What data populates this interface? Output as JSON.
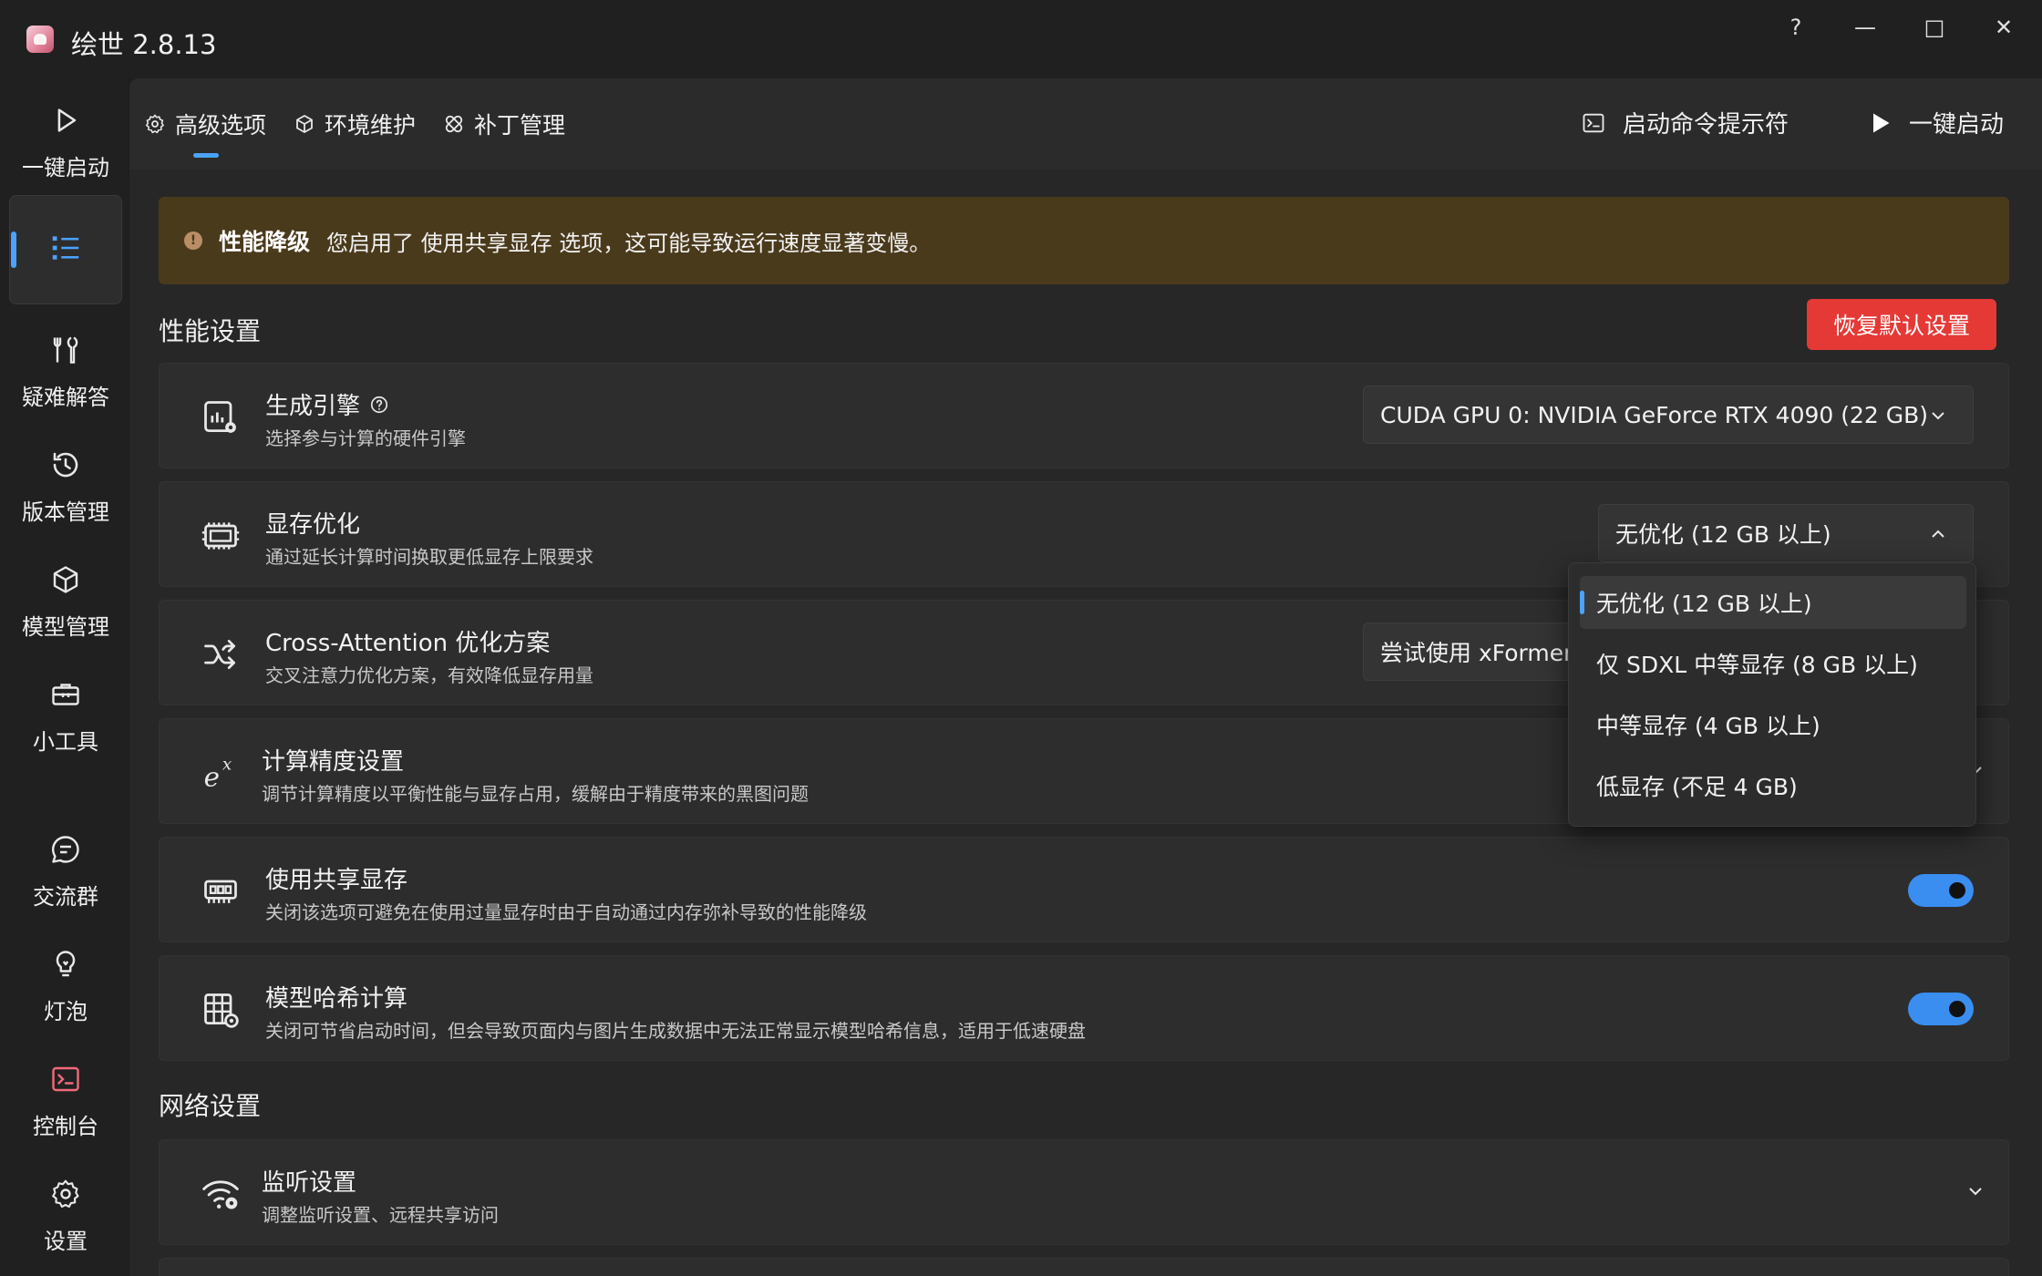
{
  "window": {
    "title": "绘世 2.8.13",
    "controls": [
      "?",
      "—",
      "□",
      "✕"
    ]
  },
  "sidebar": {
    "items": [
      {
        "label": "一键启动",
        "icon": "play-icon"
      },
      {
        "label": "",
        "icon": "list-icon"
      },
      {
        "label": "疑难解答",
        "icon": "wrench-icon"
      },
      {
        "label": "版本管理",
        "icon": "history-icon"
      },
      {
        "label": "模型管理",
        "icon": "cube-icon"
      },
      {
        "label": "小工具",
        "icon": "toolbox-icon"
      },
      {
        "label": "交流群",
        "icon": "chat-icon"
      },
      {
        "label": "灯泡",
        "icon": "bulb-icon"
      },
      {
        "label": "控制台",
        "icon": "console-icon"
      },
      {
        "label": "设置",
        "icon": "gear-icon"
      }
    ]
  },
  "tabs": [
    {
      "label": "高级选项",
      "icon": "gear-icon"
    },
    {
      "label": "环境维护",
      "icon": "box-icon"
    },
    {
      "label": "补丁管理",
      "icon": "bandage-icon"
    }
  ],
  "toolbar": {
    "cmd_label": "启动命令提示符",
    "launch_label": "一键启动"
  },
  "warning": {
    "title": "性能降级",
    "text": "您启用了 使用共享显存 选项，这可能导致运行速度显著变慢。"
  },
  "performance": {
    "section_title": "性能设置",
    "reset_label": "恢复默认设置",
    "engine": {
      "title": "生成引擎",
      "subtitle": "选择参与计算的硬件引擎",
      "value": "CUDA GPU 0: NVIDIA GeForce RTX 4090 (22 GB)"
    },
    "vram": {
      "title": "显存优化",
      "subtitle": "通过延长计算时间换取更低显存上限要求",
      "value": "无优化 (12 GB 以上)",
      "options": [
        "无优化 (12 GB 以上)",
        "仅 SDXL 中等显存 (8 GB 以上)",
        "中等显存 (4 GB 以上)",
        "低显存 (不足 4 GB)"
      ]
    },
    "cross_attention": {
      "title": "Cross-Attention 优化方案",
      "subtitle": "交叉注意力优化方案，有效降低显存用量",
      "value": "尝试使用 xFormers"
    },
    "precision": {
      "title": "计算精度设置",
      "subtitle": "调节计算精度以平衡性能与显存占用，缓解由于精度带来的黑图问题"
    },
    "shared_vram": {
      "title": "使用共享显存",
      "subtitle": "关闭该选项可避免在使用过量显存时由于自动通过内存弥补导致的性能降级",
      "enabled": true
    },
    "model_hash": {
      "title": "模型哈希计算",
      "subtitle": "关闭可节省启动时间，但会导致页面内与图片生成数据中无法正常显示模型哈希信息，适用于低速硬盘",
      "enabled": true
    }
  },
  "network": {
    "section_title": "网络设置",
    "listen": {
      "title": "监听设置",
      "subtitle": "调整监听设置、远程共享访问"
    }
  },
  "colors": {
    "accent": "#4aa3ff",
    "toggle_on": "#3a8ef0",
    "danger": "#e53935",
    "warning_bg": "#4a3a1c"
  }
}
